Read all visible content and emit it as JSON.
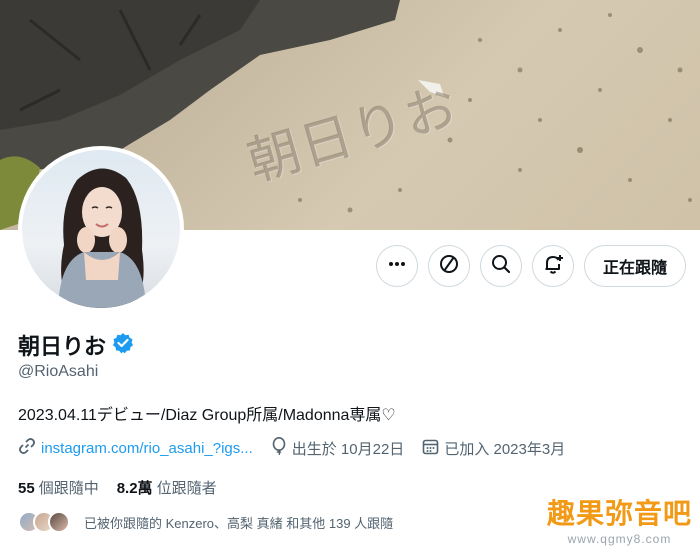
{
  "banner": {
    "sand_text": "朝日りお"
  },
  "actions": {
    "more_icon": "more-horizontal-icon",
    "grok_icon": "slash-circle-icon",
    "search_icon": "search-icon",
    "notify_icon": "bell-plus-icon",
    "follow_label": "正在跟隨"
  },
  "profile": {
    "display_name": "朝日りお",
    "verified_icon": "verified-badge-icon",
    "handle": "@RioAsahi",
    "bio": "2023.04.11デビュー/Diaz Group所属/Madonna専属♡",
    "link": "instagram.com/rio_asahi_?igs...",
    "birthday": "出生於 10月22日",
    "joined": "已加入 2023年3月"
  },
  "stats": {
    "following_count": "55",
    "following_label": "個跟隨中",
    "followers_count": "8.2萬",
    "followers_label": "位跟隨者"
  },
  "followed_by": {
    "text": "已被你跟隨的 Kenzero、高梨 真緒 和其他 139 人跟隨"
  },
  "watermark": {
    "title": "趣果弥音吧",
    "url": "www.qgmy8.com"
  },
  "colors": {
    "link": "#1d9bf0",
    "verified": "#1d9bf0",
    "secondary_text": "#536471",
    "border": "#cfd9de",
    "watermark": "#f29a16"
  }
}
